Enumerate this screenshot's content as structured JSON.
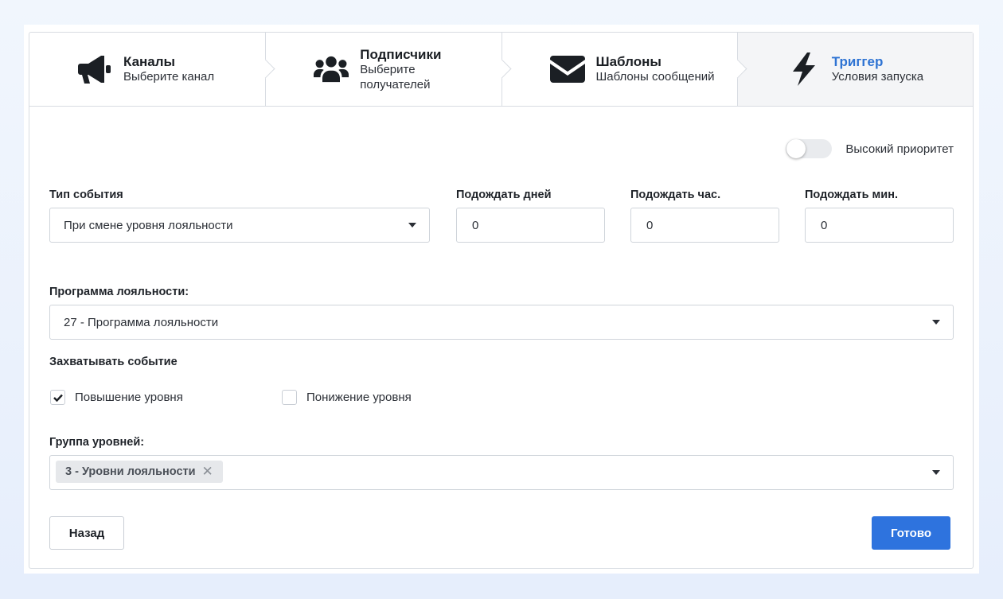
{
  "steps": [
    {
      "icon": "megaphone-icon",
      "title": "Каналы",
      "subtitle": "Выберите канал",
      "active": false
    },
    {
      "icon": "users-icon",
      "title": "Подписчики",
      "subtitle": "Выберите получателей",
      "active": false
    },
    {
      "icon": "envelope-icon",
      "title": "Шаблоны",
      "subtitle": "Шаблоны сообщений",
      "active": false
    },
    {
      "icon": "lightning-icon",
      "title": "Триггер",
      "subtitle": "Условия запуска",
      "active": true
    }
  ],
  "priority": {
    "label": "Высокий приоритет",
    "enabled": false
  },
  "event_type": {
    "label": "Тип события",
    "value": "При смене уровня лояльности"
  },
  "wait_days": {
    "label": "Подождать дней",
    "value": "0"
  },
  "wait_hours": {
    "label": "Подождать час.",
    "value": "0"
  },
  "wait_minutes": {
    "label": "Подождать мин.",
    "value": "0"
  },
  "loyalty_program": {
    "label": "Программа лояльности:",
    "value": "27 - Программа лояльности"
  },
  "capture_event": {
    "label": "Захватывать событие",
    "options": [
      {
        "label": "Повышение уровня",
        "checked": true
      },
      {
        "label": "Понижение уровня",
        "checked": false
      }
    ]
  },
  "level_group": {
    "label": "Группа уровней:",
    "chips": [
      "3 - Уровни лояльности"
    ]
  },
  "buttons": {
    "back": "Назад",
    "done": "Готово"
  },
  "colors": {
    "accent": "#2e73de",
    "active_step_title": "#2e73d3"
  }
}
